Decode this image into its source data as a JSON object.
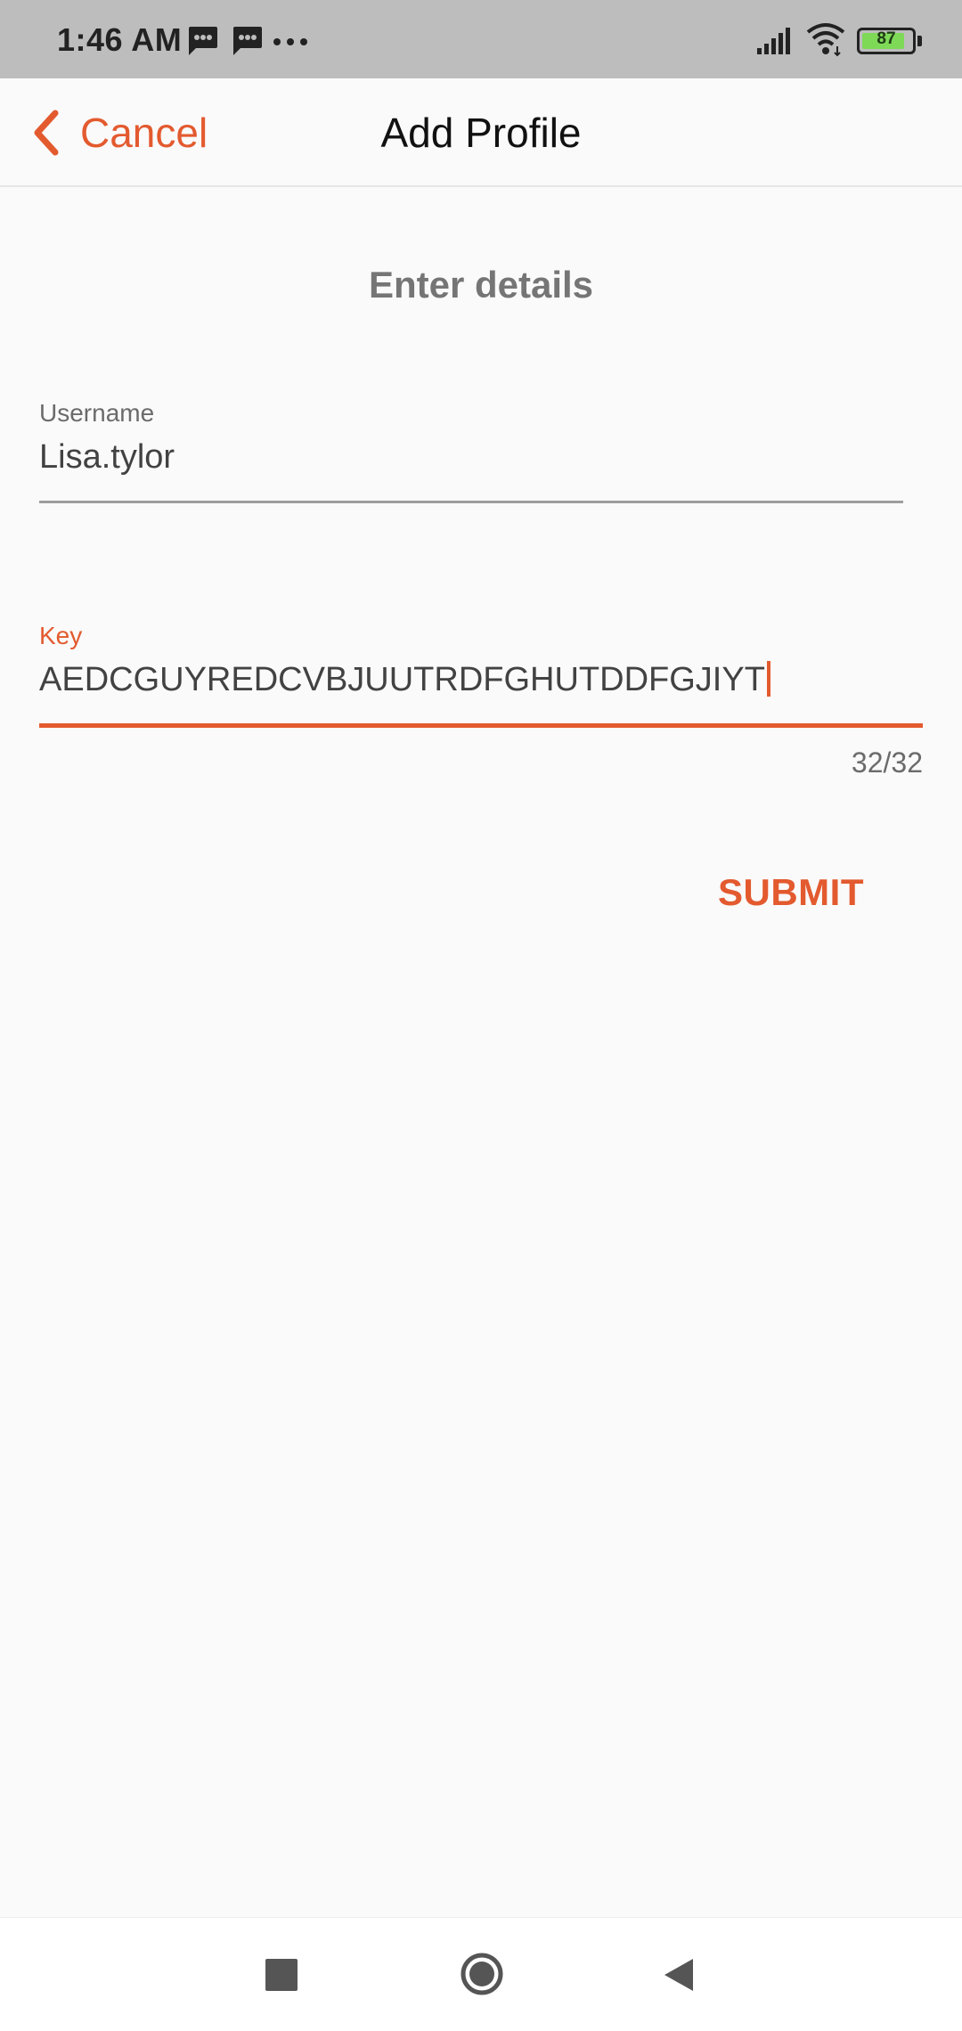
{
  "status_bar": {
    "time": "1:46 AM",
    "battery_level": "87",
    "battery_fraction": 0.87,
    "icons": [
      "message-icon",
      "message-icon",
      "more-dots-icon",
      "signal-icon",
      "wifi-icon",
      "battery-icon"
    ]
  },
  "app_bar": {
    "cancel_label": "Cancel",
    "title": "Add Profile",
    "back_icon": "chevron-left-icon"
  },
  "form": {
    "heading": "Enter details",
    "username": {
      "label": "Username",
      "value": "Lisa.tylor"
    },
    "key": {
      "label": "Key",
      "value": "AEDCGUYREDCVBJUUTRDFGHUTDDFGJIYT",
      "counter": "32/32"
    },
    "submit_label": "SUBMIT"
  },
  "nav_bar": {
    "buttons": [
      "recents-icon",
      "home-icon",
      "back-icon"
    ]
  },
  "colors": {
    "accent": "#e35a2f",
    "status_bar": "#bdbdbd",
    "background": "#fafafa",
    "battery": "#7ed957"
  }
}
